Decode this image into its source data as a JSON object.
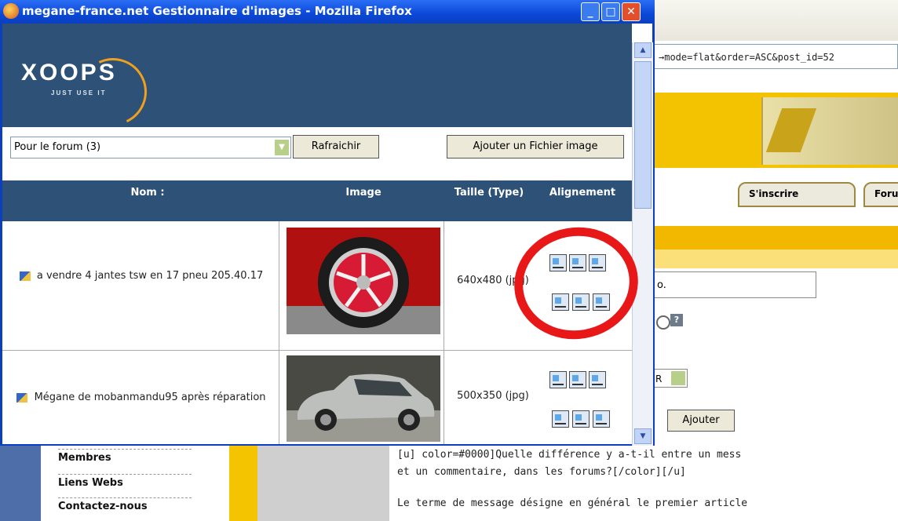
{
  "browser": {
    "title": "megane-france.net Gestionnaire d'images - Mozilla Firefox",
    "url_fragment": "→mode=flat&order=ASC&post_id=52"
  },
  "xoops": {
    "logo": "XOOPS",
    "tagline": "JUST USE IT"
  },
  "controls": {
    "category_select": "Pour le forum (3)",
    "refresh_button": "Rafraichir",
    "add_button": "Ajouter un Fichier image"
  },
  "table": {
    "headers": {
      "name": "Nom :",
      "image": "Image",
      "size": "Taille (Type)",
      "align": "Alignement"
    },
    "rows": [
      {
        "name": "a vendre 4 jantes tsw en 17 pneu 205.40.17",
        "size": "640x480 (jpg)"
      },
      {
        "name": "Mégane de mobanmandu95 après réparation",
        "size": "500x350 (jpg)"
      }
    ]
  },
  "background_page": {
    "tab_register": "S'inscrire",
    "tab_forum": "Foru",
    "input_value": "o.",
    "select_value": "R",
    "button_add": "Ajouter",
    "help": "?"
  },
  "bottom_nav": {
    "items": [
      "Membres",
      "Liens Webs",
      "Contactez-nous"
    ]
  },
  "bottom_text": {
    "line1": "[u] color=#0000]Quelle différence y a-t-il entre un mess",
    "line2": "et un commentaire, dans les forums?[/color][/u]",
    "line3": "Le terme de message désigne en général le premier article"
  },
  "colors": {
    "accent": "#2e5277",
    "annotation": "#e81818",
    "brand_yellow": "#f4c400"
  }
}
